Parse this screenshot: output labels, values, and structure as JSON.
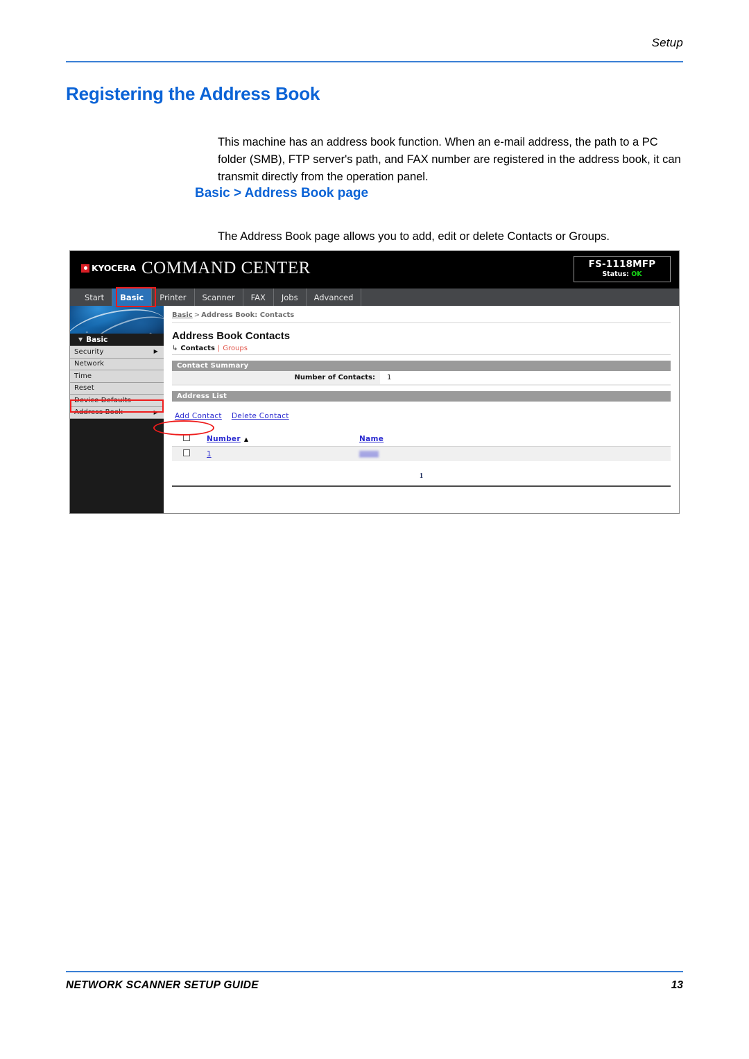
{
  "page": {
    "header_label": "Setup",
    "title": "Registering the Address Book",
    "intro_paragraph": "This machine has an address book function. When an e-mail address, the path to a PC folder (SMB), FTP server's path, and FAX number are registered in the address book, it can transmit directly from the operation panel.",
    "section_title": "Basic > Address Book page",
    "section_paragraph": "The Address Book page allows you to add, edit or delete Contacts or Groups.",
    "footer_left": "NETWORK SCANNER SETUP GUIDE",
    "footer_page_number": "13"
  },
  "colors": {
    "heading_blue": "#0b63d6",
    "rule_blue": "#3a7fd5",
    "highlight_red": "#ee1c1c",
    "active_tab_blue": "#2b72b8",
    "status_ok_green": "#17d317",
    "kyocera_red": "#d81f26",
    "section_bar_grey": "#9a9a9a",
    "link_blue": "#2a2ad0",
    "subnav_red": "#e2574c"
  },
  "screenshot": {
    "brand": {
      "logo_text": "KYOCERA",
      "product_name": "COMMAND CENTER"
    },
    "status_box": {
      "model": "FS-1118MFP",
      "status_label": "Status:",
      "status_value": "OK"
    },
    "tabs": [
      {
        "label": "Start",
        "active": false
      },
      {
        "label": "Basic",
        "active": true
      },
      {
        "label": "Printer",
        "active": false
      },
      {
        "label": "Scanner",
        "active": false
      },
      {
        "label": "FAX",
        "active": false
      },
      {
        "label": "Jobs",
        "active": false
      },
      {
        "label": "Advanced",
        "active": false
      }
    ],
    "sidebar": {
      "group_label": "Basic",
      "items": [
        {
          "label": "Security",
          "has_arrow": true,
          "highlighted": false
        },
        {
          "label": "Network",
          "has_arrow": false,
          "highlighted": false
        },
        {
          "label": "Time",
          "has_arrow": false,
          "highlighted": false
        },
        {
          "label": "Reset",
          "has_arrow": false,
          "highlighted": false
        },
        {
          "label": "Device Defaults",
          "has_arrow": false,
          "highlighted": false
        },
        {
          "label": "Address Book",
          "has_arrow": true,
          "highlighted": true
        }
      ]
    },
    "main": {
      "breadcrumb_root": "Basic",
      "breadcrumb_separator": ">",
      "breadcrumb_current": "Address Book: Contacts",
      "heading": "Address Book Contacts",
      "subnav": {
        "hook_icon": "arrow-hook-icon",
        "current": "Contacts",
        "divider": "|",
        "other": "Groups"
      },
      "contact_summary": {
        "section_label": "Contact Summary",
        "field_label": "Number of Contacts:",
        "field_value": "1"
      },
      "address_list": {
        "section_label": "Address List",
        "actions": [
          {
            "label": "Add Contact",
            "highlighted": true
          },
          {
            "label": "Delete Contact",
            "highlighted": false
          }
        ],
        "columns": [
          {
            "label": "Number",
            "sorted": true,
            "sort_direction": "ascending"
          },
          {
            "label": "Name",
            "sorted": false,
            "sort_direction": ""
          }
        ],
        "rows": [
          {
            "number": "1",
            "name": ""
          }
        ],
        "pagination": "1"
      }
    }
  }
}
